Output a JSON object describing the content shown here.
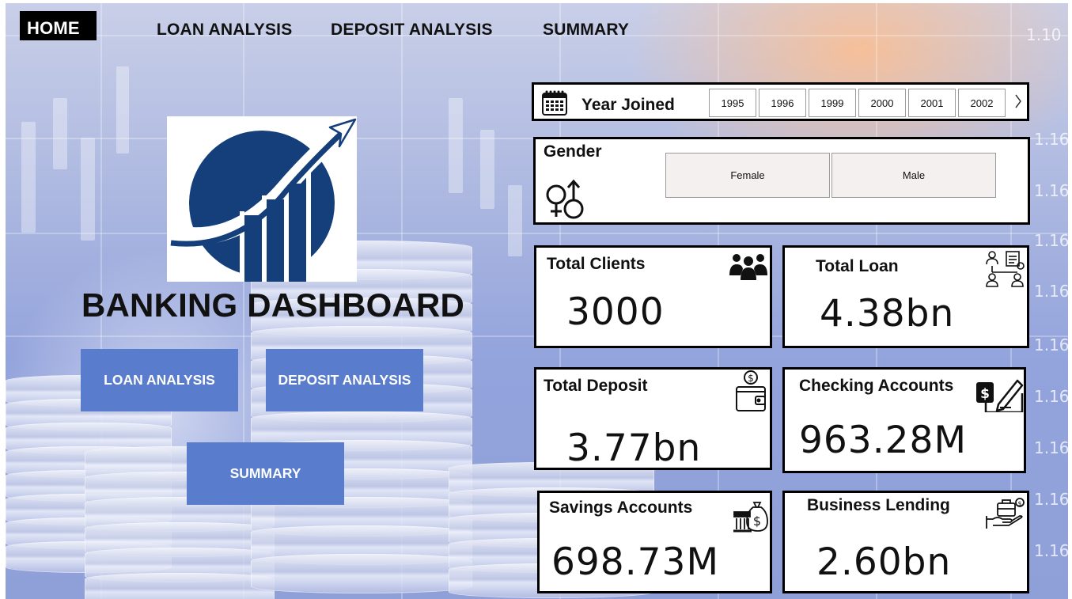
{
  "nav": {
    "home": "HOME",
    "loan_analysis": "LOAN ANALYSIS",
    "deposit_analysis": "DEPOSIT ANALYSIS",
    "summary": "SUMMARY"
  },
  "background": {
    "axis_ticks": [
      "1.10",
      "1.16",
      "1.16",
      "1.16",
      "1.16",
      "1.16",
      "1.16",
      "1.16",
      "1.16",
      "1.16",
      "1.16",
      "1.16"
    ]
  },
  "brand": {
    "title": "BANKING DASHBOARD",
    "logo_colors": {
      "navy": "#143f7a"
    }
  },
  "buttons": {
    "loan_analysis": "LOAN ANALYSIS",
    "deposit_analysis": "DEPOSIT ANALYSIS",
    "summary": "SUMMARY",
    "color": "#5a7ccd"
  },
  "slicers": {
    "year": {
      "title": "Year Joined",
      "icon": "calendar-icon",
      "options": [
        "1995",
        "1996",
        "1999",
        "2000",
        "2001",
        "2002"
      ],
      "next_icon": "chevron-right-icon"
    },
    "gender": {
      "title": "Gender",
      "icon": "gender-symbols-icon",
      "options": [
        "Female",
        "Male"
      ]
    }
  },
  "kpis": {
    "total_clients": {
      "title": "Total Clients",
      "value": "3000",
      "icon": "group-people-icon"
    },
    "total_loan": {
      "title": "Total Loan",
      "value": "4.38bn",
      "icon": "org-chart-icon"
    },
    "total_deposit": {
      "title": "Total Deposit",
      "value": "3.77bn",
      "icon": "wallet-icon"
    },
    "checking_accounts": {
      "title": "Checking Accounts",
      "value": "963.28M",
      "icon": "cheque-pen-icon"
    },
    "savings_accounts": {
      "title": "Savings Accounts",
      "value": "698.73M",
      "icon": "bank-money-icon"
    },
    "business_lending": {
      "title": "Business Lending",
      "value": "2.60bn",
      "icon": "hand-briefcase-icon"
    }
  }
}
